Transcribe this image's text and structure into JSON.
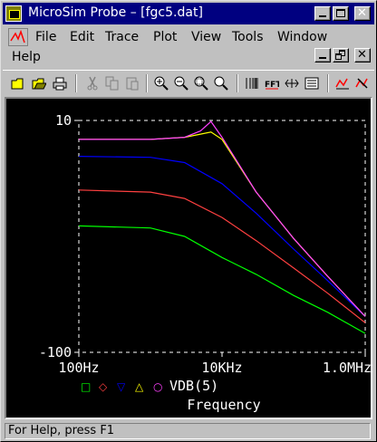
{
  "window": {
    "title": "MicroSim Probe – [fgc5.dat]"
  },
  "menu": {
    "items": [
      {
        "label": "File"
      },
      {
        "label": "Edit"
      },
      {
        "label": "Trace"
      },
      {
        "label": "Plot"
      },
      {
        "label": "View"
      },
      {
        "label": "Tools"
      },
      {
        "label": "Window"
      },
      {
        "label": "Help"
      }
    ]
  },
  "toolbar": {
    "buttons": [
      "open-file",
      "open-folder",
      "print",
      "cut",
      "copy",
      "paste",
      "zoom-in",
      "zoom-out",
      "zoom-area",
      "zoom-fit",
      "log-x",
      "fft",
      "performance-analysis",
      "eval-goal",
      "add-trace",
      "mark-trace"
    ]
  },
  "status": {
    "text": "For Help, press F1"
  },
  "colors": {
    "background": "#000000",
    "axis": "#ffffff",
    "series": [
      "#00ff00",
      "#ff4040",
      "#0000ff",
      "#ffff00",
      "#ff40ff"
    ]
  },
  "chart_data": {
    "type": "line",
    "xlabel": "Frequency",
    "ylabel": "",
    "xscale": "log",
    "xlim": [
      100,
      1000000
    ],
    "ylim": [
      -100,
      10
    ],
    "xticks": [
      "100Hz",
      "10KHz",
      "1.0MHz"
    ],
    "yticks": [
      "10",
      "-100"
    ],
    "grid": false,
    "legend_expression": "VDB(5)",
    "legend_placement": "below-plot",
    "series": [
      {
        "marker": "□",
        "color": "#00ff00",
        "x": [
          100,
          1000,
          3000,
          10000,
          30000,
          100000,
          300000,
          1000000
        ],
        "values": [
          -40,
          -41,
          -45,
          -55,
          -63,
          -73,
          -81,
          -91
        ]
      },
      {
        "marker": "◇",
        "color": "#ff4040",
        "x": [
          100,
          1000,
          3000,
          10000,
          30000,
          100000,
          300000,
          1000000
        ],
        "values": [
          -23,
          -24,
          -27,
          -36,
          -47,
          -60,
          -72,
          -86
        ]
      },
      {
        "marker": "▽",
        "color": "#0000ff",
        "x": [
          100,
          1000,
          3000,
          10000,
          30000,
          100000,
          300000,
          1000000
        ],
        "values": [
          -7,
          -7.5,
          -10,
          -20,
          -34,
          -51,
          -66,
          -83
        ]
      },
      {
        "marker": "△",
        "color": "#ffff00",
        "x": [
          100,
          1000,
          3000,
          5000,
          7000,
          10000,
          30000,
          100000,
          300000,
          1000000
        ],
        "values": [
          1,
          1,
          2,
          3.5,
          4.5,
          1,
          -24,
          -46,
          -64,
          -83
        ]
      },
      {
        "marker": "○",
        "color": "#ff40ff",
        "x": [
          100,
          1000,
          3000,
          5000,
          7000,
          10000,
          30000,
          100000,
          300000,
          1000000
        ],
        "values": [
          1,
          1,
          2,
          5,
          9.5,
          2,
          -24,
          -46,
          -64,
          -83
        ]
      }
    ]
  }
}
